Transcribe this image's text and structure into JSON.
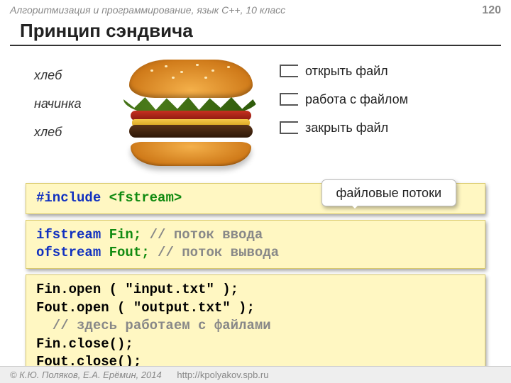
{
  "header": {
    "course": "Алгоритмизация и программирование, язык C++, 10 класс",
    "page": "120"
  },
  "title": "Принцип сэндвича",
  "sandwich": {
    "left": [
      "хлеб",
      "начинка",
      "хлеб"
    ],
    "right": [
      "открыть файл",
      "работа с  файлом",
      "закрыть файл"
    ]
  },
  "callout": "файловые потоки",
  "code1": {
    "include_kw": "#include ",
    "include_hdr": "<fstream>"
  },
  "code2": {
    "l1a": "ifstream ",
    "l1b": "Fin;  ",
    "l1c": "// поток ввода",
    "l2a": "ofstream ",
    "l2b": "Fout; ",
    "l2c": "// поток вывода"
  },
  "code3": {
    "l1": "Fin.open ( \"input.txt\" );",
    "l2": "Fout.open ( \"output.txt\" );",
    "l3": "  // здесь работаем с файлами",
    "l4": "Fin.close();",
    "l5": "Fout.close();"
  },
  "footer": {
    "copyright": "© К.Ю. Поляков, Е.А. Ерёмин, 2014",
    "url": "http://kpolyakov.spb.ru"
  }
}
